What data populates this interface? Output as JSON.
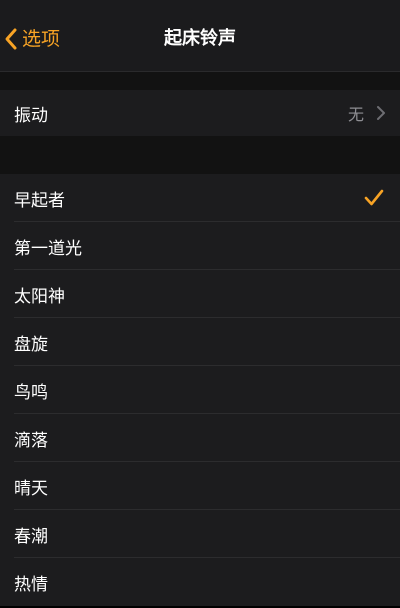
{
  "nav": {
    "back_label": "选项",
    "title": "起床铃声",
    "back_icon": "chevron-left-icon"
  },
  "vibration": {
    "label": "振动",
    "value": "无",
    "icon": "chevron-right-icon"
  },
  "ringtones": [
    {
      "label": "早起者",
      "selected": true
    },
    {
      "label": "第一道光",
      "selected": false
    },
    {
      "label": "太阳神",
      "selected": false
    },
    {
      "label": "盘旋",
      "selected": false
    },
    {
      "label": "鸟鸣",
      "selected": false
    },
    {
      "label": "滴落",
      "selected": false
    },
    {
      "label": "晴天",
      "selected": false
    },
    {
      "label": "春潮",
      "selected": false
    },
    {
      "label": "热情",
      "selected": false
    }
  ],
  "colors": {
    "accent": "#f7a325",
    "background": "#000000",
    "cell": "#1c1c1e",
    "secondary_text": "#8e8e93"
  }
}
